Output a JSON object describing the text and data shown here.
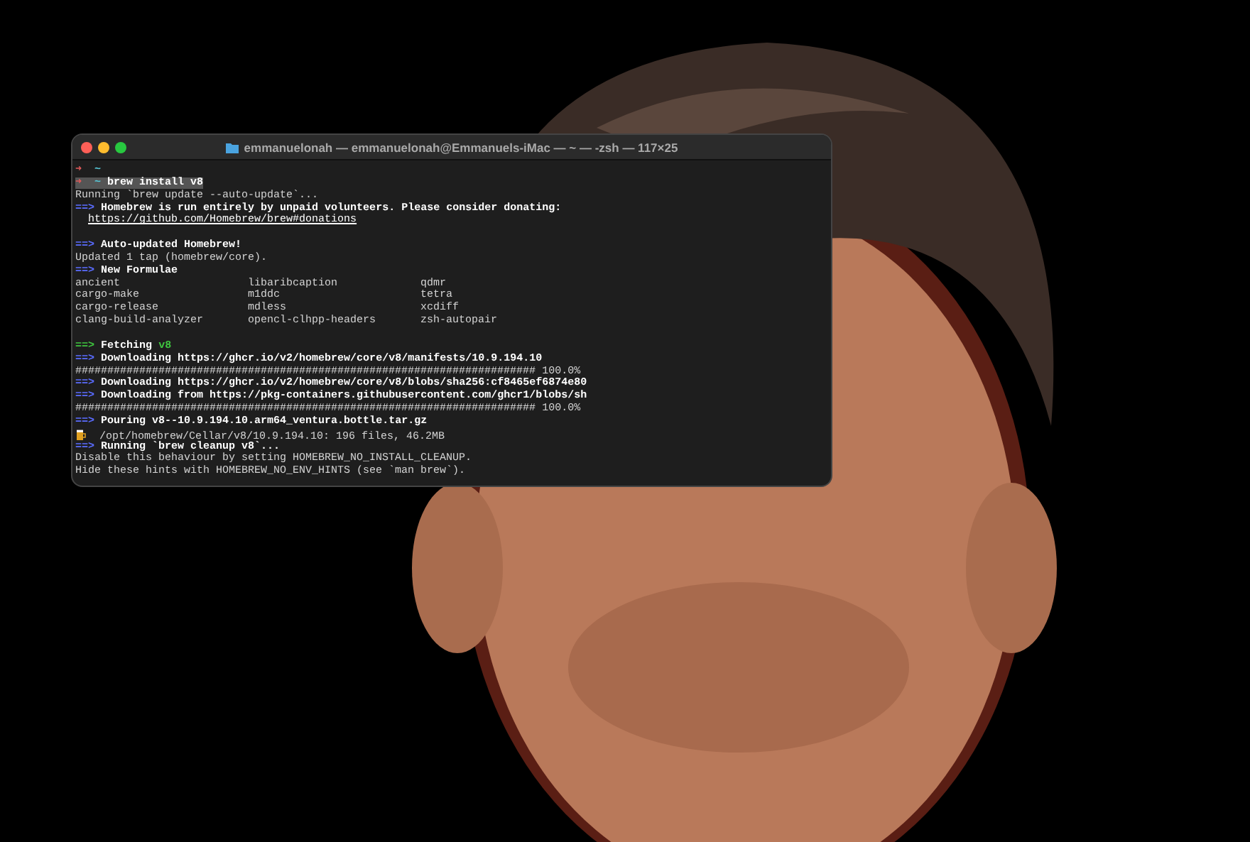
{
  "window": {
    "title": "emmanuelonah — emmanuelonah@Emmanuels-iMac — ~ — -zsh — 117×25"
  },
  "terminal": {
    "lines": [
      {
        "kind": "prompt",
        "arrow": "➜",
        "dir": "~",
        "selected": false
      },
      {
        "kind": "prompt",
        "arrow": "➜",
        "dir": "~",
        "command": "brew install v8",
        "selected": true
      },
      {
        "kind": "text",
        "text": "Running `brew update --auto-update`..."
      },
      {
        "kind": "info",
        "arrow": "==>",
        "text": "Homebrew is run entirely by unpaid volunteers. Please consider donating:"
      },
      {
        "kind": "link",
        "text": "https://github.com/Homebrew/brew#donations"
      },
      {
        "kind": "blank"
      },
      {
        "kind": "info",
        "arrow": "==>",
        "text": "Auto-updated Homebrew!"
      },
      {
        "kind": "text",
        "text": "Updated 1 tap (homebrew/core)."
      },
      {
        "kind": "info",
        "arrow": "==>",
        "text": "New Formulae"
      },
      {
        "kind": "columns",
        "cells": [
          "ancient",
          "libaribcaption",
          "qdmr"
        ]
      },
      {
        "kind": "columns",
        "cells": [
          "cargo-make",
          "m1ddc",
          "tetra"
        ]
      },
      {
        "kind": "columns",
        "cells": [
          "cargo-release",
          "mdless",
          "xcdiff"
        ]
      },
      {
        "kind": "columns",
        "cells": [
          "clang-build-analyzer",
          "opencl-clhpp-headers",
          "zsh-autopair"
        ]
      },
      {
        "kind": "blank"
      },
      {
        "kind": "success",
        "arrow": "==>",
        "text": "Fetching",
        "tag": "v8"
      },
      {
        "kind": "info",
        "arrow": "==>",
        "text": "Downloading https://ghcr.io/v2/homebrew/core/v8/manifests/10.9.194.10"
      },
      {
        "kind": "progress",
        "bar": "########################################################################",
        "reading": "100.0%"
      },
      {
        "kind": "info",
        "arrow": "==>",
        "text": "Downloading https://ghcr.io/v2/homebrew/core/v8/blobs/sha256:cf8465ef6874e80"
      },
      {
        "kind": "info",
        "arrow": "==>",
        "text": "Downloading from https://pkg-containers.githubusercontent.com/ghcr1/blobs/sh"
      },
      {
        "kind": "progress",
        "bar": "########################################################################",
        "reading": "100.0%"
      },
      {
        "kind": "info",
        "arrow": "==>",
        "text": "Pouring v8--10.9.194.10.arm64_ventura.bottle.tar.gz"
      },
      {
        "kind": "file",
        "text": "/opt/homebrew/Cellar/v8/10.9.194.10: 196 files, 46.2MB"
      },
      {
        "kind": "info",
        "arrow": "==>",
        "text": "Running `brew cleanup v8`..."
      },
      {
        "kind": "text",
        "text": "Disable this behaviour by setting HOMEBREW_NO_INSTALL_CLEANUP."
      },
      {
        "kind": "text",
        "text": "Hide these hints with HOMEBREW_NO_ENV_HINTS (see `man brew`)."
      }
    ]
  }
}
